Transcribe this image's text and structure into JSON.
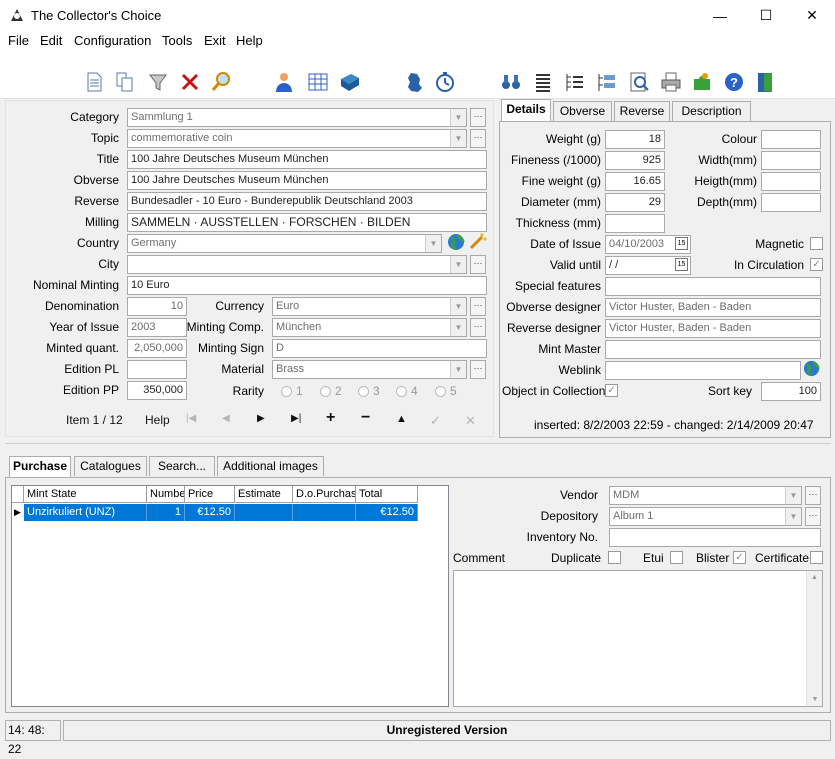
{
  "window": {
    "title": "The Collector's Choice",
    "minimize": "—",
    "maximize": "☐",
    "close": "✕"
  },
  "menu": [
    "File",
    "Edit",
    "Configuration",
    "Tools",
    "Exit",
    "Help"
  ],
  "toolbar_icons": [
    "new-document-icon",
    "copy-document-icon",
    "filter-icon",
    "delete-icon",
    "search-icon",
    "user-icon",
    "table-icon",
    "book-icon",
    "germany-map-icon",
    "stopwatch-icon",
    "binoculars-icon",
    "list-icon",
    "tree-list-icon",
    "tree-view-icon",
    "preview-icon",
    "printer-icon",
    "puzzle-icon",
    "help-icon",
    "exit-door-icon"
  ],
  "form": {
    "labels": {
      "category": "Category",
      "topic": "Topic",
      "title": "Title",
      "obverse": "Obverse",
      "reverse": "Reverse",
      "milling": "Milling",
      "country": "Country",
      "city": "City",
      "nominal_minting": "Nominal Minting",
      "denomination": "Denomination",
      "year_of_issue": "Year of Issue",
      "minted_quant": "Minted quant.",
      "edition_pl": "Edition PL",
      "edition_pp": "Edition PP",
      "currency": "Currency",
      "minting_comp": "Minting Comp.",
      "minting_sign": "Minting Sign",
      "material": "Material",
      "rarity": "Rarity"
    },
    "values": {
      "category": "Sammlung 1",
      "topic": "commemorative coin",
      "title": "100 Jahre Deutsches Museum München",
      "obverse": "100 Jahre Deutsches Museum München",
      "reverse": "Bundesadler - 10 Euro - Bunderepublik Deutschland 2003",
      "milling": "SAMMELN · AUSSTELLEN · FORSCHEN · BILDEN",
      "country": "Germany",
      "city": "",
      "nominal_minting": "10 Euro",
      "denomination": "10",
      "year_of_issue": "2003",
      "minted_quant": "2,050,000",
      "edition_pl": "",
      "edition_pp": "350,000",
      "currency": "Euro",
      "minting_comp": "München",
      "minting_sign": "D",
      "material": "Brass"
    },
    "rarity_options": [
      "1",
      "2",
      "3",
      "4",
      "5"
    ]
  },
  "nav": {
    "item_counter": "Item 1 / 12",
    "help": "Help",
    "first": "|◀",
    "prev": "◀",
    "next": "▶",
    "last": "▶|",
    "add": "+",
    "remove": "−",
    "up": "▲",
    "confirm": "✓",
    "cancel": "✕"
  },
  "details": {
    "tabs": [
      "Details",
      "Obverse",
      "Reverse",
      "Description"
    ],
    "labels": {
      "weight": "Weight (g)",
      "fineness": "Fineness (/1000)",
      "fine_weight": "Fine weight (g)",
      "diameter": "Diameter (mm)",
      "thickness": "Thickness (mm)",
      "date_of_issue": "Date of Issue",
      "valid_until": "Valid until",
      "special_features": "Special features",
      "obverse_designer": "Obverse designer",
      "reverse_designer": "Reverse designer",
      "mint_master": "Mint Master",
      "weblink": "Weblink",
      "object_in_collection": "Object in Collection",
      "colour": "Colour",
      "width": "Width(mm)",
      "height": "Heigth(mm)",
      "depth": "Depth(mm)",
      "magnetic": "Magnetic",
      "in_circulation": "In Circulation",
      "sort_key": "Sort key"
    },
    "values": {
      "weight": "18",
      "fineness": "925",
      "fine_weight": "16.65",
      "diameter": "29",
      "thickness": "",
      "date_of_issue": "04/10/2003",
      "valid_until": " /  / ",
      "special_features": "",
      "obverse_designer": "Victor Huster, Baden - Baden",
      "reverse_designer": "Victor Huster, Baden - Baden",
      "mint_master": "",
      "weblink": "",
      "colour": "",
      "width": "",
      "height": "",
      "depth": "",
      "sort_key": "100"
    },
    "checks": {
      "magnetic": "",
      "in_circulation": "✓",
      "object_in_collection": "✓"
    },
    "timestamps": "inserted: 8/2/2003 22:59 - changed: 2/14/2009 20:47"
  },
  "bottom_tabs": [
    "Purchase",
    "Catalogues",
    "Search...",
    "Additional images"
  ],
  "purchase_grid": {
    "columns": [
      "Mint State",
      "Numbe",
      "Price",
      "Estimate",
      "D.o.Purchas",
      "Total"
    ],
    "rows": [
      [
        "Unzirkuliert (UNZ)",
        "1",
        "€12.50",
        "",
        "",
        "€12.50"
      ]
    ]
  },
  "purchase_details": {
    "vendor_label": "Vendor",
    "vendor": "MDM",
    "depository_label": "Depository",
    "depository": "Album 1",
    "inventory_label": "Inventory No.",
    "inventory": "",
    "comment_label": "Comment",
    "duplicate_label": "Duplicate",
    "etui_label": "Etui",
    "blister_label": "Blister",
    "certificate_label": "Certificate",
    "blister_check": "✓"
  },
  "status": {
    "time": "14: 48: 22",
    "message": "Unregistered Version"
  }
}
